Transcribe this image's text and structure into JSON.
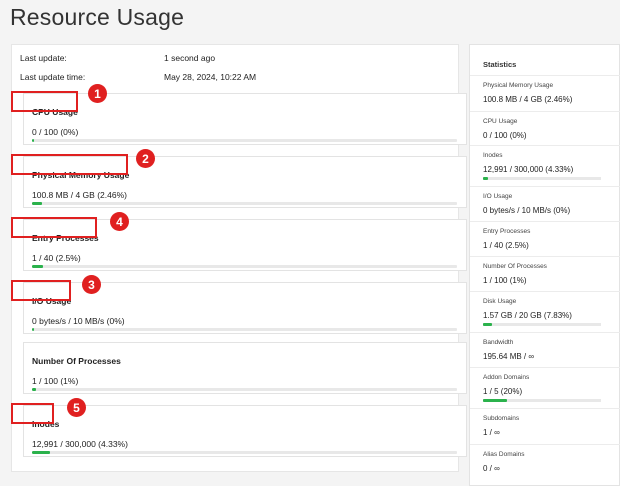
{
  "page": {
    "title": "Resource Usage"
  },
  "meta": {
    "last_update_label": "Last update:",
    "last_update_value": "1 second ago",
    "last_update_time_label": "Last update time:",
    "last_update_time_value": "May 28, 2024, 10:22 AM"
  },
  "cards": [
    {
      "title": "CPU Usage",
      "value": "0 / 100   (0%)",
      "progress_percent": 0
    },
    {
      "title": "Physical Memory Usage",
      "value": "100.8 MB / 4 GB   (2.46%)",
      "progress_percent": 2.46
    },
    {
      "title": "Entry Processes",
      "value": "1 / 40   (2.5%)",
      "progress_percent": 2.5
    },
    {
      "title": "I/O Usage",
      "value": "0 bytes/s / 10 MB/s    (0%)",
      "progress_percent": 0
    },
    {
      "title": "Number Of Processes",
      "value": "1 / 100   (1%)",
      "progress_percent": 1
    },
    {
      "title": "Inodes",
      "value": "12,991 / 300,000   (4.33%)",
      "progress_percent": 4.33
    }
  ],
  "annotations": [
    "1",
    "2",
    "4",
    "3",
    "5"
  ],
  "statistics": {
    "heading": "Statistics",
    "items": [
      {
        "label": "Physical Memory Usage",
        "value": "100.8 MB / 4 GB   (2.46%)"
      },
      {
        "label": "CPU Usage",
        "value": "0 / 100   (0%)"
      },
      {
        "label": "Inodes",
        "value": "12,991 / 300,000   (4.33%)",
        "progress_percent": 4.33
      },
      {
        "label": "I/O Usage",
        "value": "0 bytes/s / 10 MB/s    (0%)"
      },
      {
        "label": "Entry Processes",
        "value": "1 / 40   (2.5%)"
      },
      {
        "label": "Number Of Processes",
        "value": "1 / 100   (1%)"
      },
      {
        "label": "Disk Usage",
        "value": "1.57 GB / 20 GB   (7.83%)",
        "progress_percent": 7.83
      },
      {
        "label": "Bandwidth",
        "value": "195.64 MB / ∞"
      },
      {
        "label": "Addon Domains",
        "value": "1 / 5   (20%)",
        "progress_percent": 20
      },
      {
        "label": "Subdomains",
        "value": "1 / ∞"
      },
      {
        "label": "Alias Domains",
        "value": "0 / ∞"
      }
    ]
  },
  "colors": {
    "progress": "#2bb24c",
    "annotation": "#e02020"
  }
}
